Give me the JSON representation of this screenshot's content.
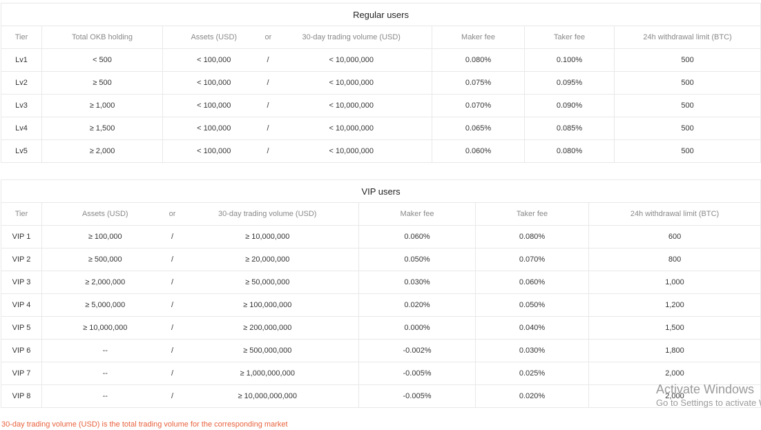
{
  "regular": {
    "title": "Regular users",
    "headers": {
      "tier": "Tier",
      "okb": "Total OKB holding",
      "assets": "Assets (USD)",
      "or": "or",
      "volume": "30-day trading volume (USD)",
      "maker": "Maker fee",
      "taker": "Taker fee",
      "withdrawal": "24h withdrawal limit (BTC)"
    },
    "rows": [
      {
        "tier": "Lv1",
        "okb": "< 500",
        "assets": "< 100,000",
        "sep": "/",
        "volume": "< 10,000,000",
        "maker": "0.080%",
        "taker": "0.100%",
        "withdrawal": "500"
      },
      {
        "tier": "Lv2",
        "okb": "≥ 500",
        "assets": "< 100,000",
        "sep": "/",
        "volume": "< 10,000,000",
        "maker": "0.075%",
        "taker": "0.095%",
        "withdrawal": "500"
      },
      {
        "tier": "Lv3",
        "okb": "≥ 1,000",
        "assets": "< 100,000",
        "sep": "/",
        "volume": "< 10,000,000",
        "maker": "0.070%",
        "taker": "0.090%",
        "withdrawal": "500"
      },
      {
        "tier": "Lv4",
        "okb": "≥ 1,500",
        "assets": "< 100,000",
        "sep": "/",
        "volume": "< 10,000,000",
        "maker": "0.065%",
        "taker": "0.085%",
        "withdrawal": "500"
      },
      {
        "tier": "Lv5",
        "okb": "≥ 2,000",
        "assets": "< 100,000",
        "sep": "/",
        "volume": "< 10,000,000",
        "maker": "0.060%",
        "taker": "0.080%",
        "withdrawal": "500"
      }
    ]
  },
  "vip": {
    "title": "VIP users",
    "headers": {
      "tier": "Tier",
      "assets": "Assets (USD)",
      "or": "or",
      "volume": "30-day trading volume (USD)",
      "maker": "Maker fee",
      "taker": "Taker fee",
      "withdrawal": "24h withdrawal limit (BTC)"
    },
    "rows": [
      {
        "tier": "VIP 1",
        "assets": "≥ 100,000",
        "sep": "/",
        "volume": "≥ 10,000,000",
        "maker": "0.060%",
        "taker": "0.080%",
        "withdrawal": "600"
      },
      {
        "tier": "VIP 2",
        "assets": "≥ 500,000",
        "sep": "/",
        "volume": "≥ 20,000,000",
        "maker": "0.050%",
        "taker": "0.070%",
        "withdrawal": "800"
      },
      {
        "tier": "VIP 3",
        "assets": "≥ 2,000,000",
        "sep": "/",
        "volume": "≥ 50,000,000",
        "maker": "0.030%",
        "taker": "0.060%",
        "withdrawal": "1,000"
      },
      {
        "tier": "VIP 4",
        "assets": "≥ 5,000,000",
        "sep": "/",
        "volume": "≥ 100,000,000",
        "maker": "0.020%",
        "taker": "0.050%",
        "withdrawal": "1,200"
      },
      {
        "tier": "VIP 5",
        "assets": "≥ 10,000,000",
        "sep": "/",
        "volume": "≥ 200,000,000",
        "maker": "0.000%",
        "taker": "0.040%",
        "withdrawal": "1,500"
      },
      {
        "tier": "VIP 6",
        "assets": "--",
        "sep": "/",
        "volume": "≥ 500,000,000",
        "maker": "-0.002%",
        "taker": "0.030%",
        "withdrawal": "1,800"
      },
      {
        "tier": "VIP 7",
        "assets": "--",
        "sep": "/",
        "volume": "≥ 1,000,000,000",
        "maker": "-0.005%",
        "taker": "0.025%",
        "withdrawal": "2,000"
      },
      {
        "tier": "VIP 8",
        "assets": "--",
        "sep": "/",
        "volume": "≥ 10,000,000,000",
        "maker": "-0.005%",
        "taker": "0.020%",
        "withdrawal": "2,000"
      }
    ]
  },
  "footnote": "30-day trading volume (USD) is the total trading volume for the corresponding market",
  "watermark": {
    "line1": "Activate Windows",
    "line2": "Go to Settings to activate Windows."
  },
  "colors": {
    "footnote": "#e8613c",
    "border": "#e8e8e8",
    "header_text": "#888888",
    "watermark": "#9a9a9a"
  }
}
